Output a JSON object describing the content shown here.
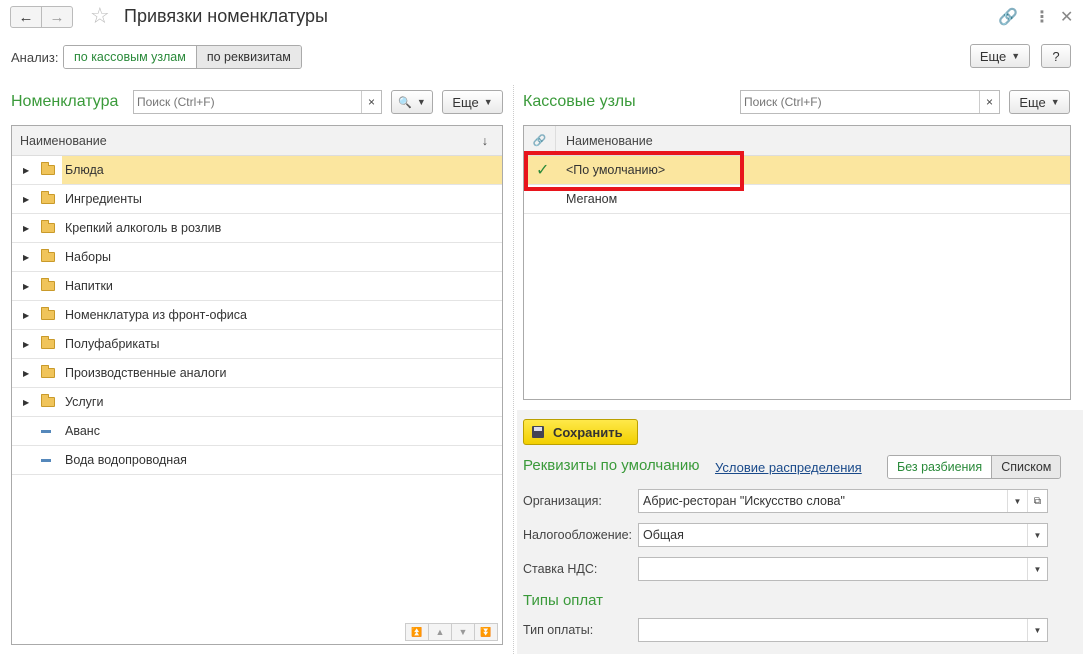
{
  "window": {
    "title": "Привязки номенклатуры",
    "back_icon": "←",
    "forward_icon": "→",
    "star_icon": "☆",
    "link_icon": "🔗",
    "more_icon": "⋮",
    "close_icon": "✕"
  },
  "analysis": {
    "label": "Анализ:",
    "options": [
      "по кассовым узлам",
      "по реквизитам"
    ],
    "selected": "по кассовым узлам"
  },
  "top_more_label": "Еще",
  "help_label": "?",
  "nomenclature": {
    "title": "Номенклатура",
    "search_placeholder": "Поиск (Ctrl+F)",
    "clear_icon": "×",
    "find_icon": "🔍",
    "more_label": "Еще",
    "column_header": "Наименование",
    "sort_icon": "↓",
    "rows": [
      {
        "name": "Блюда",
        "type": "folder",
        "selected": true
      },
      {
        "name": "Ингредиенты",
        "type": "folder"
      },
      {
        "name": "Крепкий алкоголь в розлив",
        "type": "folder"
      },
      {
        "name": "Наборы",
        "type": "folder"
      },
      {
        "name": "Напитки",
        "type": "folder"
      },
      {
        "name": "Номенклатура из фронт-офиса",
        "type": "folder"
      },
      {
        "name": "Полуфабрикаты",
        "type": "folder"
      },
      {
        "name": "Производственные аналоги",
        "type": "folder"
      },
      {
        "name": "Услуги",
        "type": "folder"
      },
      {
        "name": "Аванс",
        "type": "item"
      },
      {
        "name": "Вода водопроводная",
        "type": "item"
      }
    ],
    "scroll_icons": [
      "⏫",
      "▲",
      "▼",
      "⏬"
    ]
  },
  "cash_nodes": {
    "title": "Кассовые узлы",
    "search_placeholder": "Поиск (Ctrl+F)",
    "clear_icon": "×",
    "more_label": "Еще",
    "column_link_icon": "🔗",
    "column_header": "Наименование",
    "check_icon": "✓",
    "rows": [
      {
        "name": "<По умолчанию>",
        "linked": true,
        "selected": true
      },
      {
        "name": "Меганом",
        "linked": false
      }
    ]
  },
  "save_label": "Сохранить",
  "defaults": {
    "title": "Реквизиты по умолчанию",
    "condition_link": "Условие распределения",
    "split_options": [
      "Без разбиения",
      "Списком"
    ],
    "split_selected": "Без разбиения",
    "fields": [
      {
        "label": "Организация:",
        "value": "Абрис-ресторан \"Искусство слова\""
      },
      {
        "label": "Налогообложение:",
        "value": "Общая"
      },
      {
        "label": "Ставка НДС:",
        "value": ""
      }
    ]
  },
  "payments": {
    "title": "Типы оплат",
    "field_label": "Тип оплаты:",
    "field_value": ""
  },
  "colors": {
    "accent_green": "#3a9a3a",
    "selection": "#fbe69f",
    "highlight_frame": "#e8141c",
    "save_button": "#f2cf00"
  }
}
